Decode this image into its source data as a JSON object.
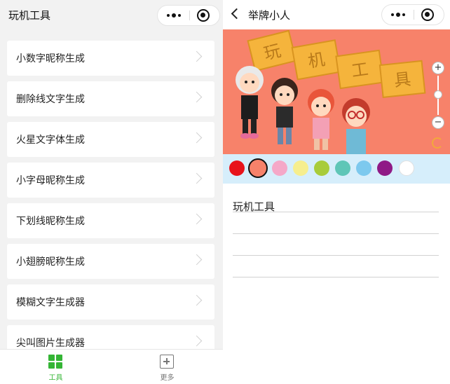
{
  "left": {
    "title": "玩机工具",
    "items": [
      {
        "label": "小数字昵称生成"
      },
      {
        "label": "删除线文字生成"
      },
      {
        "label": "火星文字体生成"
      },
      {
        "label": "小字母昵称生成"
      },
      {
        "label": "下划线昵称生成"
      },
      {
        "label": "小翅膀昵称生成"
      },
      {
        "label": "模糊文字生成器"
      },
      {
        "label": "尖叫图片生成器"
      }
    ],
    "tabs": [
      {
        "label": "工具",
        "icon": "grid-icon",
        "active": true,
        "color": "#34b535"
      },
      {
        "label": "更多",
        "icon": "plus-square-icon",
        "active": false,
        "color": "#777777"
      }
    ]
  },
  "right": {
    "title": "举牌小人",
    "banner": {
      "sign_chars": [
        "玩",
        "机",
        "工",
        "具"
      ],
      "background": "#f7826a"
    },
    "zoom": {
      "plus": "+",
      "minus": "−"
    },
    "palette": [
      {
        "color": "#e8131b",
        "selected": false
      },
      {
        "color": "#f7826a",
        "selected": true
      },
      {
        "color": "#f5a8c8",
        "selected": false
      },
      {
        "color": "#f6ee8e",
        "selected": false
      },
      {
        "color": "#a8cc3a",
        "selected": false
      },
      {
        "color": "#5fc6b7",
        "selected": false
      },
      {
        "color": "#7dc9ee",
        "selected": false
      },
      {
        "color": "#8f1a86",
        "selected": false
      },
      {
        "color": "#ffffff",
        "selected": false
      }
    ],
    "text_value": "玩机工具"
  }
}
